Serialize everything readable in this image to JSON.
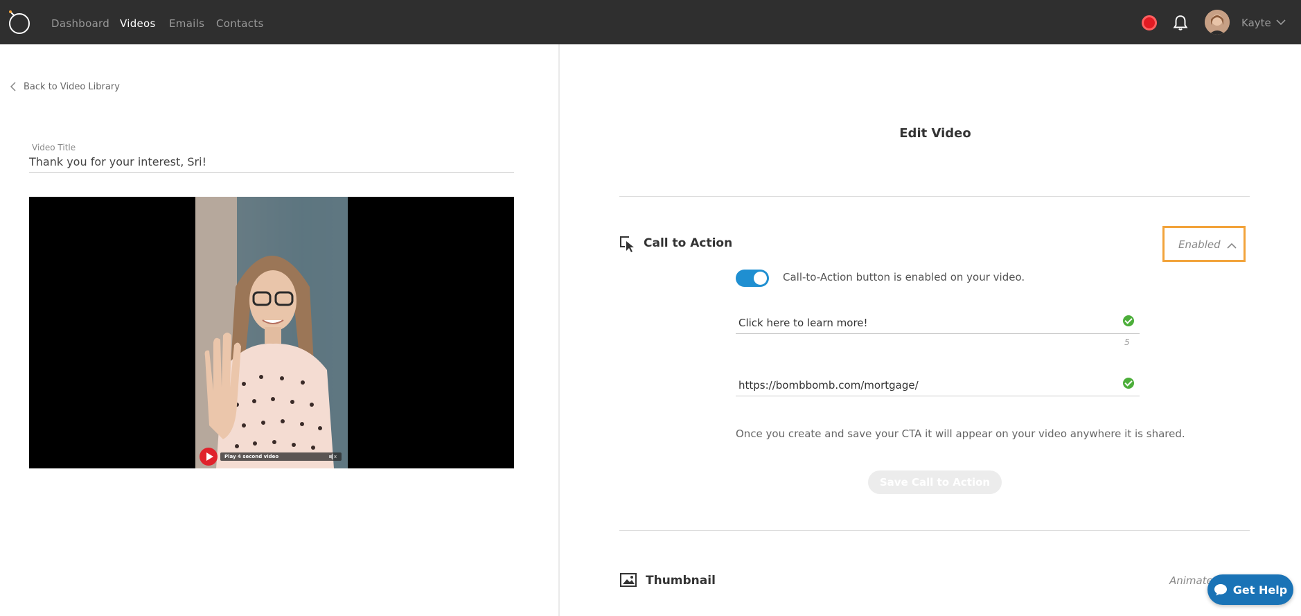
{
  "nav": {
    "links": [
      "Dashboard",
      "Videos",
      "Emails",
      "Contacts"
    ],
    "active": "Videos",
    "user_name": "Kayte"
  },
  "left": {
    "back_label": "Back to Video Library",
    "title_label": "Video Title",
    "title_value": "Thank you for your interest, Sri!",
    "video_play_label": "Play 4 second video"
  },
  "right": {
    "page_title": "Edit Video",
    "cta": {
      "section_title": "Call to Action",
      "status": "Enabled",
      "toggle_label": "Call-to-Action button is enabled on your video.",
      "button_text": "Click here to learn more!",
      "char_count": "5",
      "url": "https://bombbomb.com/mortgage/",
      "info": "Once you create and save your CTA it will appear on your video anywhere it is shared.",
      "save_label": "Save Call to Action"
    },
    "thumbnail": {
      "section_title": "Thumbnail",
      "status": "Animate"
    }
  },
  "help_label": "Get Help",
  "colors": {
    "topbar": "#2f2f2f",
    "toggle": "#1f8fd1",
    "highlight": "#f2a33a",
    "check": "#4cae3a",
    "record": "#e21b23",
    "help": "#1a73b6"
  }
}
